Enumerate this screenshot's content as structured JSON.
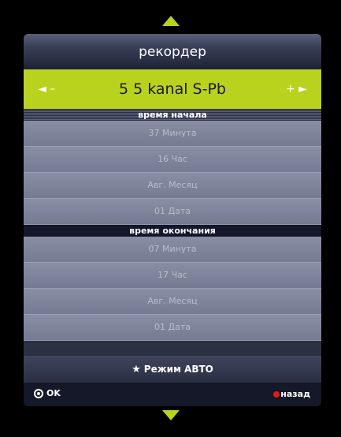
{
  "dialog": {
    "title": "рекордер",
    "channel": {
      "name": "5 5 kanal S-Pb",
      "prev_label": "◄ –",
      "next_label": "+ ►"
    }
  },
  "start_section": {
    "header": "время начала",
    "rows": [
      "37 Минута",
      "16 Час",
      "Авг. Месяц",
      "01 Дата"
    ]
  },
  "end_section": {
    "header": "время окончания",
    "rows": [
      "07 Минута",
      "17 Час",
      "Авг. Месяц",
      "01 Дата"
    ]
  },
  "mode": {
    "label": "Режим АВТО",
    "icon": "star-icon"
  },
  "footer": {
    "ok_label": "OK",
    "back_label": "назад",
    "back_color": "#e01818"
  },
  "colors": {
    "accent": "#b9d21e",
    "background": "#000000"
  }
}
